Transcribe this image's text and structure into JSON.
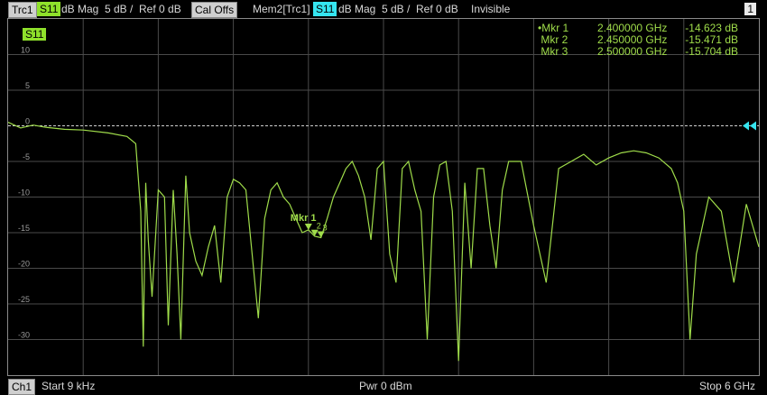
{
  "header": {
    "trace_label": "Trc1",
    "param_label": "S11",
    "format": "dB Mag",
    "scale": "5 dB /",
    "reference": "Ref 0 dB",
    "cal_status": "Cal Offs",
    "mem_label": "Mem2[Trc1]",
    "mem_param": "S11",
    "mem_format": "dB Mag",
    "mem_scale": "5 dB /",
    "mem_reference": "Ref 0 dB",
    "mem_state": "Invisible",
    "channel_number": "1"
  },
  "trace_tag": "S11",
  "markers": [
    {
      "name": "Mkr 1",
      "freq": "2.400000 GHz",
      "value": "-14.623 dB",
      "active": true
    },
    {
      "name": "Mkr 2",
      "freq": "2.450000 GHz",
      "value": "-15.471 dB",
      "active": false
    },
    {
      "name": "Mkr 3",
      "freq": "2.500000 GHz",
      "value": "-15.704 dB",
      "active": false
    }
  ],
  "marker_plot_label": "Mkr 1",
  "marker_plot_sublabels": [
    "2",
    "3"
  ],
  "footer": {
    "channel": "Ch1",
    "start": "Start  9 kHz",
    "power": "Pwr  0 dBm",
    "stop": "Stop  6 GHz"
  },
  "colors": {
    "trace": "#9fdc4a",
    "memory_marker": "#35e5f0",
    "grid": "#4a4a4a",
    "ref_line": "#cfcfcf",
    "background": "#000000"
  },
  "chart_data": {
    "type": "line",
    "xlim_hz": [
      9000,
      6000000000
    ],
    "ylim": [
      -35,
      15
    ],
    "y_ticks": [
      10,
      5,
      0,
      -5,
      -10,
      -15,
      -20,
      -25,
      -30
    ],
    "y_tick_labels": [
      "10",
      "5",
      "0",
      "-5",
      "-10",
      "-15",
      "-20",
      "-25",
      "-30"
    ],
    "reference_level": 0,
    "grid": true,
    "series": [
      {
        "x_ghz": [
          0.0,
          0.1,
          0.2,
          0.3,
          0.45,
          0.6,
          0.8,
          0.95,
          1.02,
          1.06,
          1.08,
          1.1,
          1.12,
          1.15,
          1.2,
          1.25,
          1.28,
          1.32,
          1.35,
          1.38,
          1.42,
          1.45,
          1.5,
          1.55,
          1.6,
          1.65,
          1.7,
          1.75,
          1.8,
          1.85,
          1.9,
          1.95,
          2.0,
          2.05,
          2.1,
          2.15,
          2.2,
          2.25,
          2.3,
          2.35,
          2.4,
          2.45,
          2.5,
          2.55,
          2.6,
          2.65,
          2.7,
          2.75,
          2.8,
          2.85,
          2.9,
          2.95,
          3.0,
          3.05,
          3.1,
          3.15,
          3.2,
          3.25,
          3.3,
          3.35,
          3.4,
          3.45,
          3.5,
          3.55,
          3.6,
          3.65,
          3.7,
          3.75,
          3.8,
          3.85,
          3.9,
          3.95,
          4.0,
          4.1,
          4.2,
          4.3,
          4.4,
          4.5,
          4.6,
          4.7,
          4.8,
          4.9,
          5.0,
          5.1,
          5.2,
          5.3,
          5.35,
          5.4,
          5.45,
          5.5,
          5.6,
          5.7,
          5.8,
          5.9,
          6.0
        ],
        "y_db": [
          0.5,
          -0.3,
          0.1,
          -0.2,
          -0.5,
          -0.6,
          -1.0,
          -1.5,
          -2.5,
          -12,
          -31,
          -8,
          -16,
          -24,
          -9,
          -10,
          -28,
          -9,
          -18,
          -30,
          -7,
          -15,
          -19,
          -21,
          -17,
          -14,
          -22,
          -10,
          -7.5,
          -8,
          -9,
          -18,
          -27,
          -13,
          -9,
          -8,
          -10,
          -11,
          -13,
          -15,
          -14.6,
          -15.5,
          -15.7,
          -13,
          -10,
          -8,
          -6,
          -5,
          -7,
          -10,
          -16,
          -6,
          -5,
          -18,
          -22,
          -6,
          -5,
          -9,
          -12,
          -30,
          -10,
          -5.5,
          -5,
          -12,
          -33,
          -8,
          -20,
          -6,
          -6,
          -14,
          -20,
          -9,
          -5,
          -5,
          -14,
          -22,
          -6,
          -5,
          -4,
          -5.5,
          -4.5,
          -3.8,
          -3.5,
          -3.8,
          -4.5,
          -6,
          -8,
          -12,
          -30,
          -18,
          -10,
          -12,
          -22,
          -11,
          -17
        ]
      }
    ]
  }
}
